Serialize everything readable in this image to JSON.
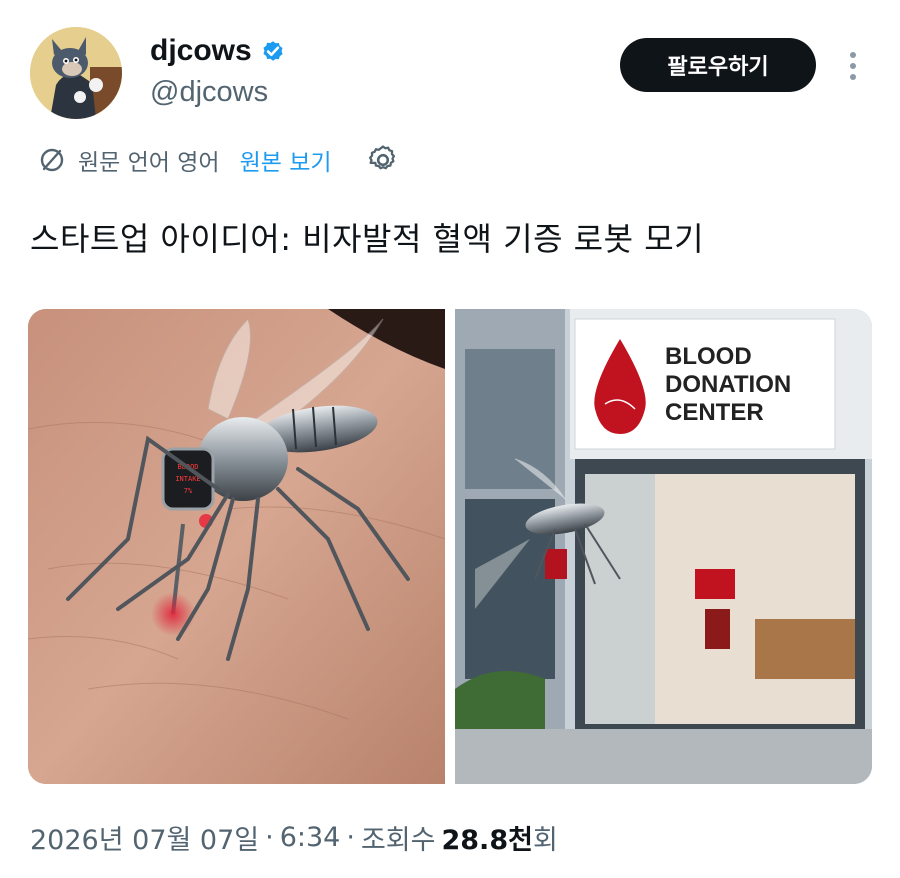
{
  "author": {
    "display_name": "djcows",
    "handle": "@djcows"
  },
  "actions": {
    "follow_label": "팔로우하기"
  },
  "translation": {
    "info": "원문 언어 영어",
    "view_original": "원본 보기"
  },
  "tweet": {
    "text": "스타트업 아이디어: 비자발적 혈액 기증 로봇 모기"
  },
  "media": {
    "left_image": {
      "screen_line1": "BLOOD",
      "screen_line2": "INTAKE",
      "screen_line3": "7%"
    },
    "right_image": {
      "sign_line1": "BLOOD",
      "sign_line2": "DONATION",
      "sign_line3": "CENTER"
    }
  },
  "meta": {
    "date": "2026년 07월 07일",
    "sep1": "·",
    "time": "6:34",
    "sep2": "·",
    "views_label": "조회수",
    "views_count": "28.8",
    "views_unit": "천",
    "views_suffix": "회"
  },
  "colors": {
    "link": "#1d9bf0",
    "text": "#0f1419",
    "muted": "#536471",
    "verified": "#1d9bf0"
  }
}
